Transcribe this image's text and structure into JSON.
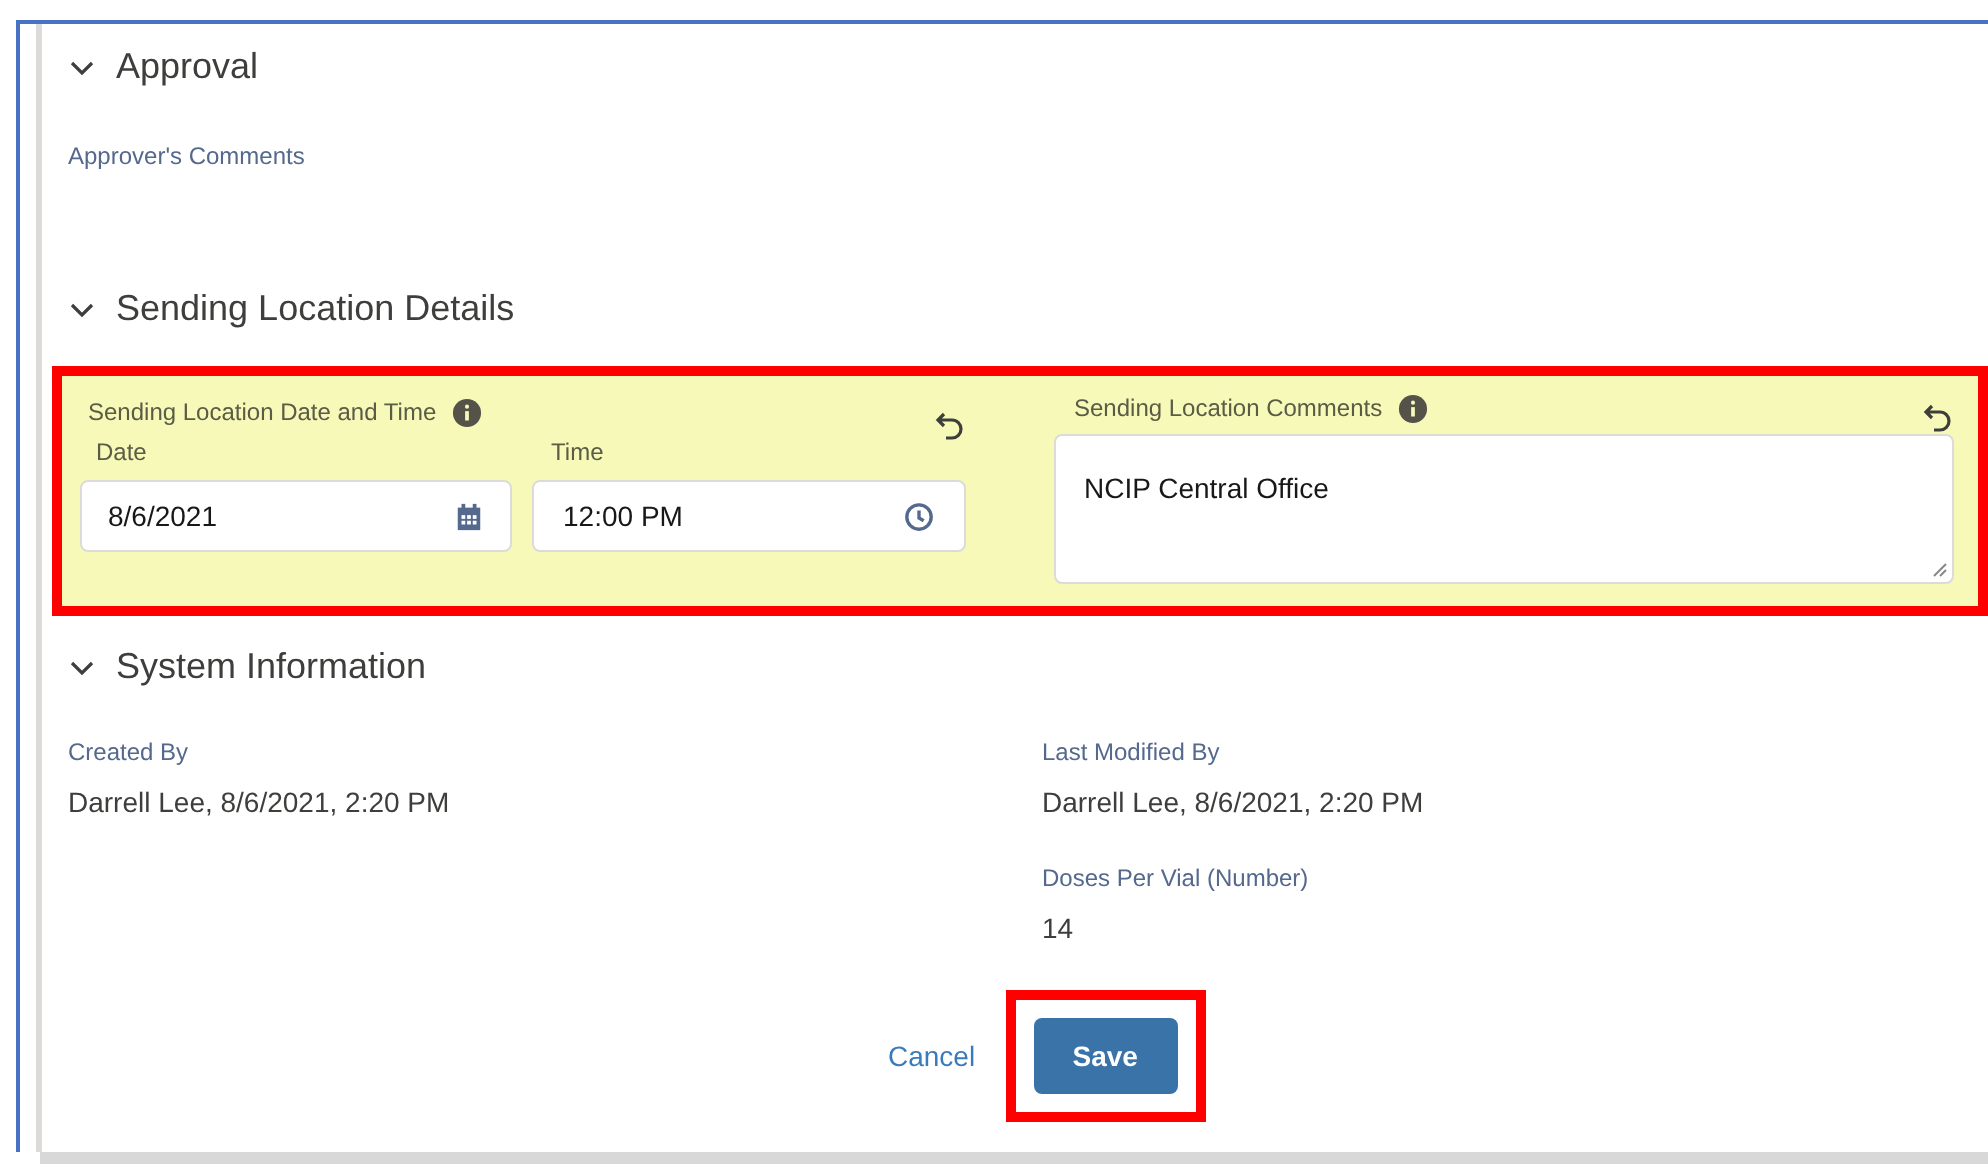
{
  "approval": {
    "title": "Approval",
    "expanded": true,
    "fields": [
      {
        "label": "Approver's Comments"
      }
    ]
  },
  "sending_location": {
    "title": "Sending Location Details",
    "expanded": true,
    "highlighted": true,
    "date_time": {
      "label": "Sending Location Date and Time",
      "date_label": "Date",
      "date_value": "8/6/2021",
      "time_label": "Time",
      "time_value": "12:00 PM"
    },
    "comments": {
      "label": "Sending Location Comments",
      "value": "NCIP Central Office"
    }
  },
  "system_information": {
    "title": "System Information",
    "expanded": true,
    "left": [
      {
        "label": "Created By",
        "value": "Darrell Lee, 8/6/2021, 2:20 PM"
      }
    ],
    "right": [
      {
        "label": "Last Modified By",
        "value": "Darrell Lee, 8/6/2021, 2:20 PM"
      },
      {
        "label": "Doses Per Vial (Number)",
        "value": "14"
      }
    ]
  },
  "footer": {
    "cancel": "Cancel",
    "save": "Save",
    "save_highlighted": true
  }
}
